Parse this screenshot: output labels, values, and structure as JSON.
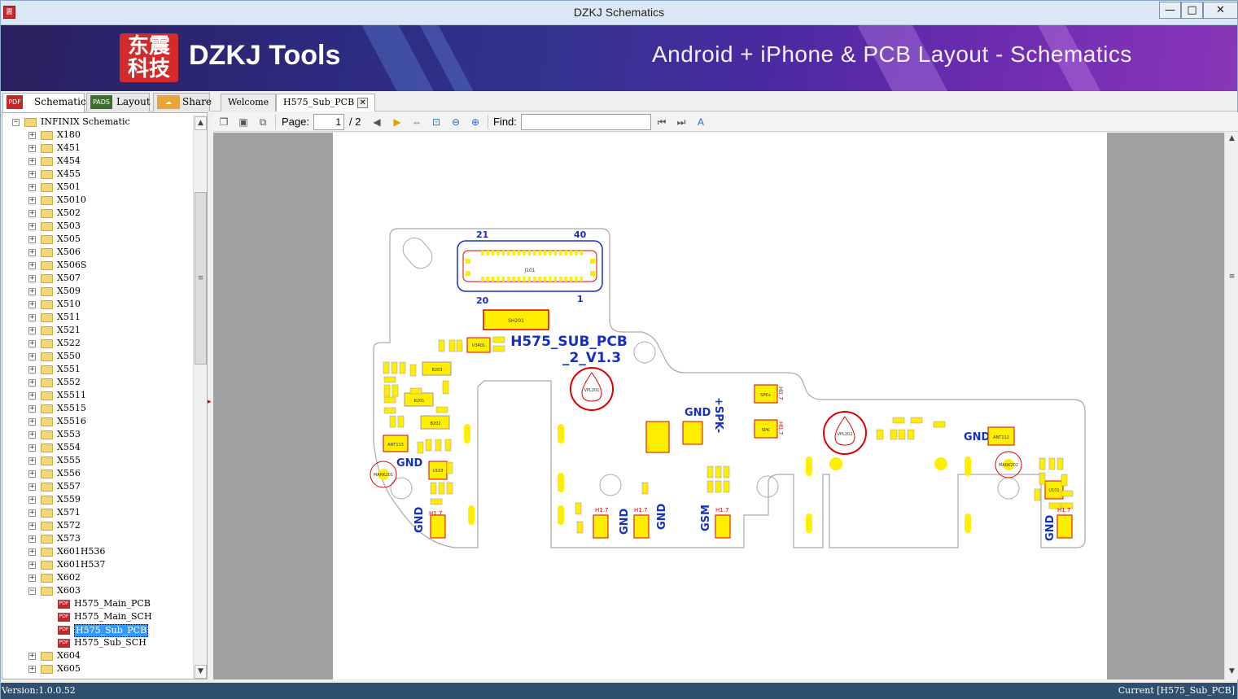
{
  "window": {
    "title": "DZKJ Schematics",
    "app_icon": "app-logo-icon",
    "min_glyph": "—",
    "max_glyph": "□",
    "close_glyph": "✕"
  },
  "banner": {
    "logo_chars": "东震\n科技",
    "brand": "DZKJ Tools",
    "tagline": "Android + iPhone & PCB Layout - Schematics"
  },
  "top_tabs": [
    {
      "label": "Schematic",
      "icon": "PDF",
      "active": true
    },
    {
      "label": "Layout",
      "icon": "PADS",
      "active": false
    },
    {
      "label": "Share",
      "icon": "share-cloud-icon",
      "active": false
    }
  ],
  "doc_tabs": [
    {
      "label": "Welcome",
      "active": false
    },
    {
      "label": "H575_Sub_PCB",
      "active": true,
      "closable": true
    }
  ],
  "tree": {
    "root": "INFINIX Schematic",
    "folders": [
      "X180",
      "X451",
      "X454",
      "X455",
      "X501",
      "X5010",
      "X502",
      "X503",
      "X505",
      "X506",
      "X506S",
      "X507",
      "X509",
      "X510",
      "X511",
      "X521",
      "X522",
      "X550",
      "X551",
      "X552",
      "X5511",
      "X5515",
      "X5516",
      "X553",
      "X554",
      "X555",
      "X556",
      "X557",
      "X559",
      "X571",
      "X572",
      "X573",
      "X601H536",
      "X601H537",
      "X602",
      "X603"
    ],
    "x603_children": [
      "H575_Main_PCB",
      "H575_Main_SCH",
      "H575_Sub_PCB",
      "H575_Sub_SCH"
    ],
    "after": [
      "X604",
      "X605"
    ],
    "selected": "H575_Sub_PCB"
  },
  "toolbar": {
    "page_label": "Page:",
    "page_current": "1",
    "page_total": "/ 2",
    "find_label": "Find:",
    "find_value": ""
  },
  "pcb": {
    "title_line1": "H575_SUB_PCB",
    "title_line2": "_2_V1.3",
    "connector": "J101",
    "pin_21": "21",
    "pin_40": "40",
    "pin_20": "20",
    "pin_1": "1",
    "sh": "SH201",
    "spk_label": "+SPK-",
    "gnd": "GND",
    "gsm": "GSM",
    "mark201": "MARK201",
    "mark202": "MARK202",
    "vpl201": "VPL201",
    "vpl202": "VPL202",
    "ant113": "ANT113",
    "ant112": "ANT112",
    "u103": "U103",
    "u101": "U101",
    "u3401": "U3401",
    "b203": "B203",
    "b201": "B201",
    "b202": "B202",
    "h17": "H1.7",
    "h07": "H0.7",
    "spk_plus": "SPK+",
    "spk_minus": "SPK-"
  },
  "status": {
    "version": "Version:1.0.0.52",
    "current": "Current [H575_Sub_PCB]"
  }
}
